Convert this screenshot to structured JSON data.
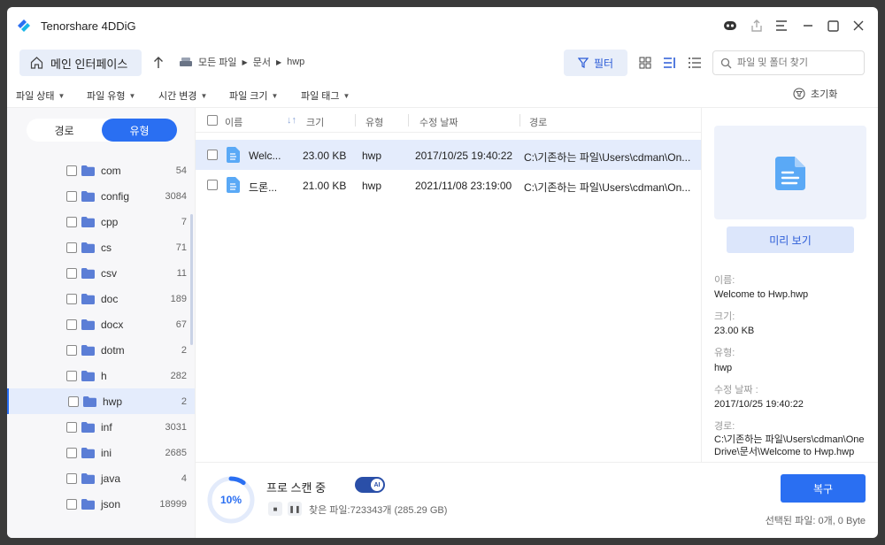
{
  "app": {
    "title": "Tenorshare 4DDiG"
  },
  "nav": {
    "home_label": "메인 인터페이스",
    "breadcrumb": [
      "모든 파일",
      "문서",
      "hwp"
    ],
    "filter_label": "필터",
    "search_placeholder": "파일 및 폴더 찾기"
  },
  "filters": {
    "items": [
      "파일 상태",
      "파일 유형",
      "시간 변경",
      "파일 크기",
      "파일 태그"
    ],
    "reset_label": "초기화"
  },
  "sidebar": {
    "tabs": [
      "경로",
      "유형"
    ],
    "active_tab": "유형",
    "items": [
      {
        "label": "com",
        "count": "54"
      },
      {
        "label": "config",
        "count": "3084"
      },
      {
        "label": "cpp",
        "count": "7"
      },
      {
        "label": "cs",
        "count": "71"
      },
      {
        "label": "csv",
        "count": "11"
      },
      {
        "label": "doc",
        "count": "189"
      },
      {
        "label": "docx",
        "count": "67"
      },
      {
        "label": "dotm",
        "count": "2"
      },
      {
        "label": "h",
        "count": "282"
      },
      {
        "label": "hwp",
        "count": "2"
      },
      {
        "label": "inf",
        "count": "3031"
      },
      {
        "label": "ini",
        "count": "2685"
      },
      {
        "label": "java",
        "count": "4"
      },
      {
        "label": "json",
        "count": "18999"
      }
    ],
    "selected": "hwp"
  },
  "files": {
    "headers": [
      "이름",
      "크기",
      "유형",
      "수정 날짜",
      "경로"
    ],
    "rows": [
      {
        "name": "Welc...",
        "size": "23.00 KB",
        "type": "hwp",
        "date": "2017/10/25 19:40:22",
        "path": "C:\\기존하는 파일\\Users\\cdman\\On..."
      },
      {
        "name": "드론...",
        "size": "21.00 KB",
        "type": "hwp",
        "date": "2021/11/08 23:19:00",
        "path": "C:\\기존하는 파일\\Users\\cdman\\On..."
      }
    ]
  },
  "preview": {
    "button_label": "미리 보기",
    "name_label": "이름:",
    "name_value": "Welcome to Hwp.hwp",
    "size_label": "크기:",
    "size_value": "23.00 KB",
    "type_label": "유형:",
    "type_value": "hwp",
    "date_label": "수정 날짜 :",
    "date_value": "2017/10/25 19:40:22",
    "path_label": "경로:",
    "path_value": "C:\\기존하는 파일\\Users\\cdman\\OneDrive\\문서\\Welcome to Hwp.hwp"
  },
  "scan": {
    "progress": "10%",
    "progress_value": 0.1,
    "title": "프로 스캔 중",
    "ai_badge": "AI",
    "found_text": "찾은 파일:723343개 (285.29 GB)",
    "recover_label": "복구",
    "selection_info": "선택된 파일: 0개, 0 Byte"
  },
  "colors": {
    "accent": "#2a6ff2",
    "selected_bg": "#e4ecfc"
  }
}
